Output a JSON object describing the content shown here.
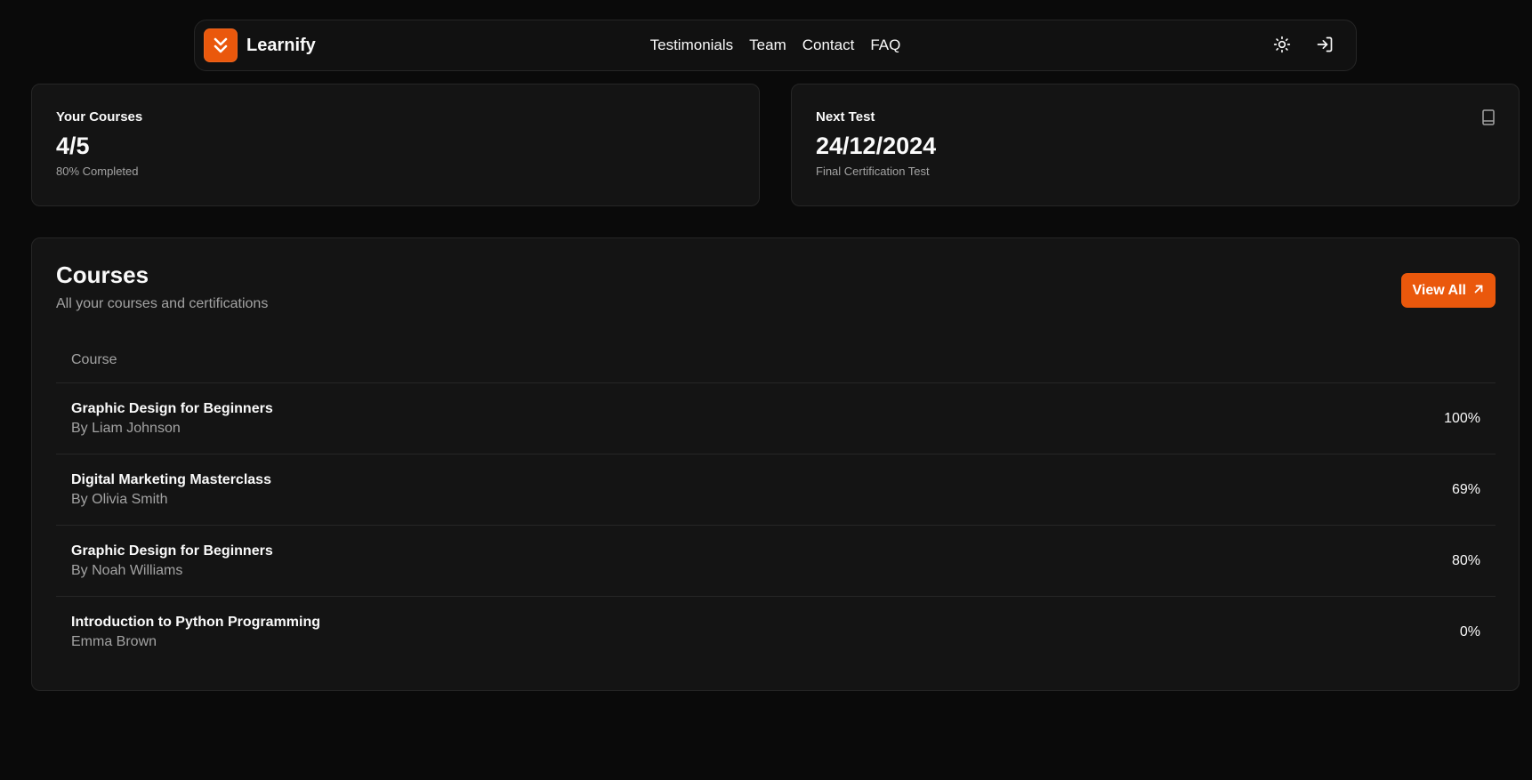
{
  "brand": {
    "name": "Learnify",
    "accent": "#ea580c"
  },
  "nav": {
    "links": [
      "Testimonials",
      "Team",
      "Contact",
      "FAQ"
    ],
    "actions": [
      "sun-icon",
      "login-icon"
    ]
  },
  "stats": {
    "courses": {
      "title": "Your Courses",
      "value": "4/5",
      "sub": "80% Completed"
    },
    "next_test": {
      "title": "Next Test",
      "value": "24/12/2024",
      "sub": "Final Certification Test",
      "icon": "book-icon"
    }
  },
  "courses": {
    "title": "Courses",
    "subtitle": "All your courses and certifications",
    "view_all_label": "View All",
    "column_header": "Course",
    "rows": [
      {
        "name": "Graphic Design for Beginners",
        "author": "By Liam Johnson",
        "progress": "100%"
      },
      {
        "name": "Digital Marketing Masterclass",
        "author": "By Olivia Smith",
        "progress": "69%"
      },
      {
        "name": "Graphic Design for Beginners",
        "author": "By Noah Williams",
        "progress": "80%"
      },
      {
        "name": "Introduction to Python Programming",
        "author": "Emma Brown",
        "progress": "0%"
      }
    ]
  }
}
